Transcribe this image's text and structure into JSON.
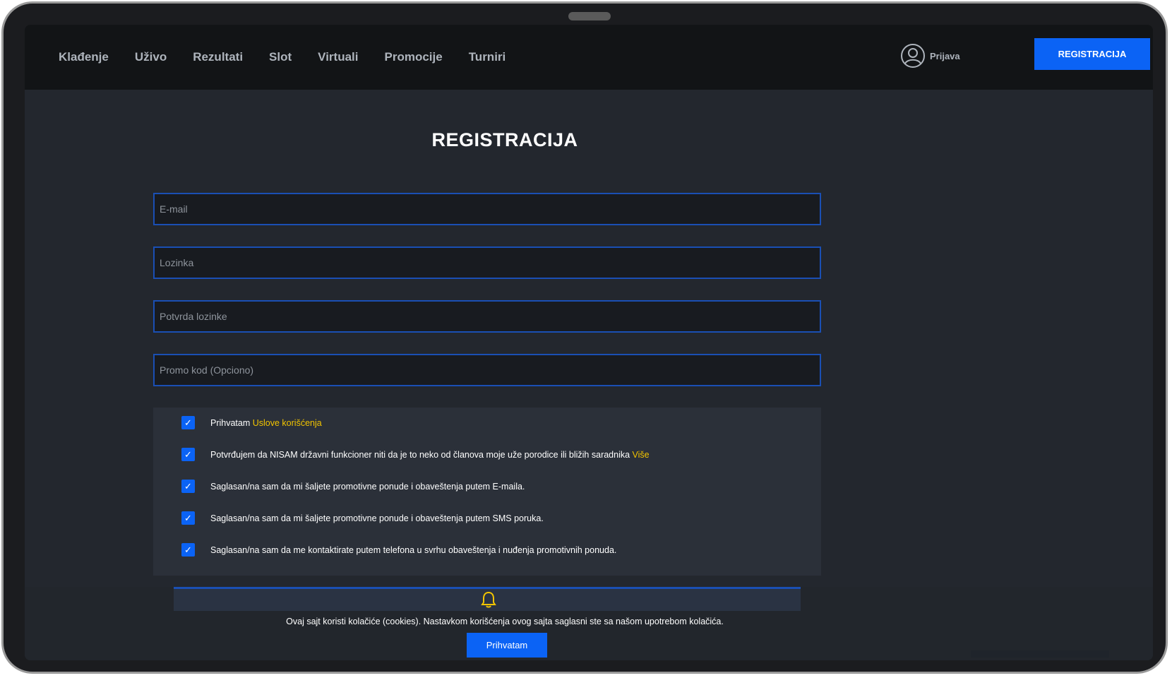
{
  "nav": {
    "items": [
      {
        "label": "Klađenje",
        "name": "nav-kladjenje"
      },
      {
        "label": "Uživo",
        "name": "nav-uzivo"
      },
      {
        "label": "Rezultati",
        "name": "nav-rezultati"
      },
      {
        "label": "Slot",
        "name": "nav-slot"
      },
      {
        "label": "Virtuali",
        "name": "nav-virtuali"
      },
      {
        "label": "Promocije",
        "name": "nav-promocije"
      },
      {
        "label": "Turniri",
        "name": "nav-turniri"
      }
    ],
    "login_label": "Prijava",
    "login_icon": "user-circle-icon",
    "register_label": "REGISTRACIJA"
  },
  "form": {
    "title": "REGISTRACIJA",
    "email_placeholder": "E-mail",
    "password_placeholder": "Lozinka",
    "confirm_password_placeholder": "Potvrda lozinke",
    "promo_placeholder": "Promo kod (Opciono)",
    "consents": [
      {
        "text": "Prihvatam ",
        "link": "Uslove korišćenja",
        "checked": true
      },
      {
        "text": "Potvrđujem da NISAM državni funkcioner niti da je to neko od članova moje uže porodice ili bližih saradnika ",
        "link": "Više",
        "checked": true
      },
      {
        "text": "Saglasan/na sam da mi šaljete promotivne ponude i obaveštenja putem E-maila.",
        "link": "",
        "checked": true
      },
      {
        "text": "Saglasan/na sam da mi šaljete promotivne ponude i obaveštenja putem SMS poruka.",
        "link": "",
        "checked": true
      },
      {
        "text": "Saglasan/na sam da me kontaktirate putem telefona u svrhu obaveštenja i nuđenja promotivnih ponuda.",
        "link": "",
        "checked": true
      }
    ]
  },
  "cookie": {
    "text": "Ovaj sajt koristi kolačiće (cookies). Nastavkom korišćenja ovog sajta saglasni ste sa našom upotrebom kolačića.",
    "accept_label": "Prihvatam",
    "icon": "bell-icon"
  },
  "colors": {
    "accent": "#0b63f5",
    "link": "#f2c400",
    "background": "#23272e",
    "topbar": "#121416"
  }
}
